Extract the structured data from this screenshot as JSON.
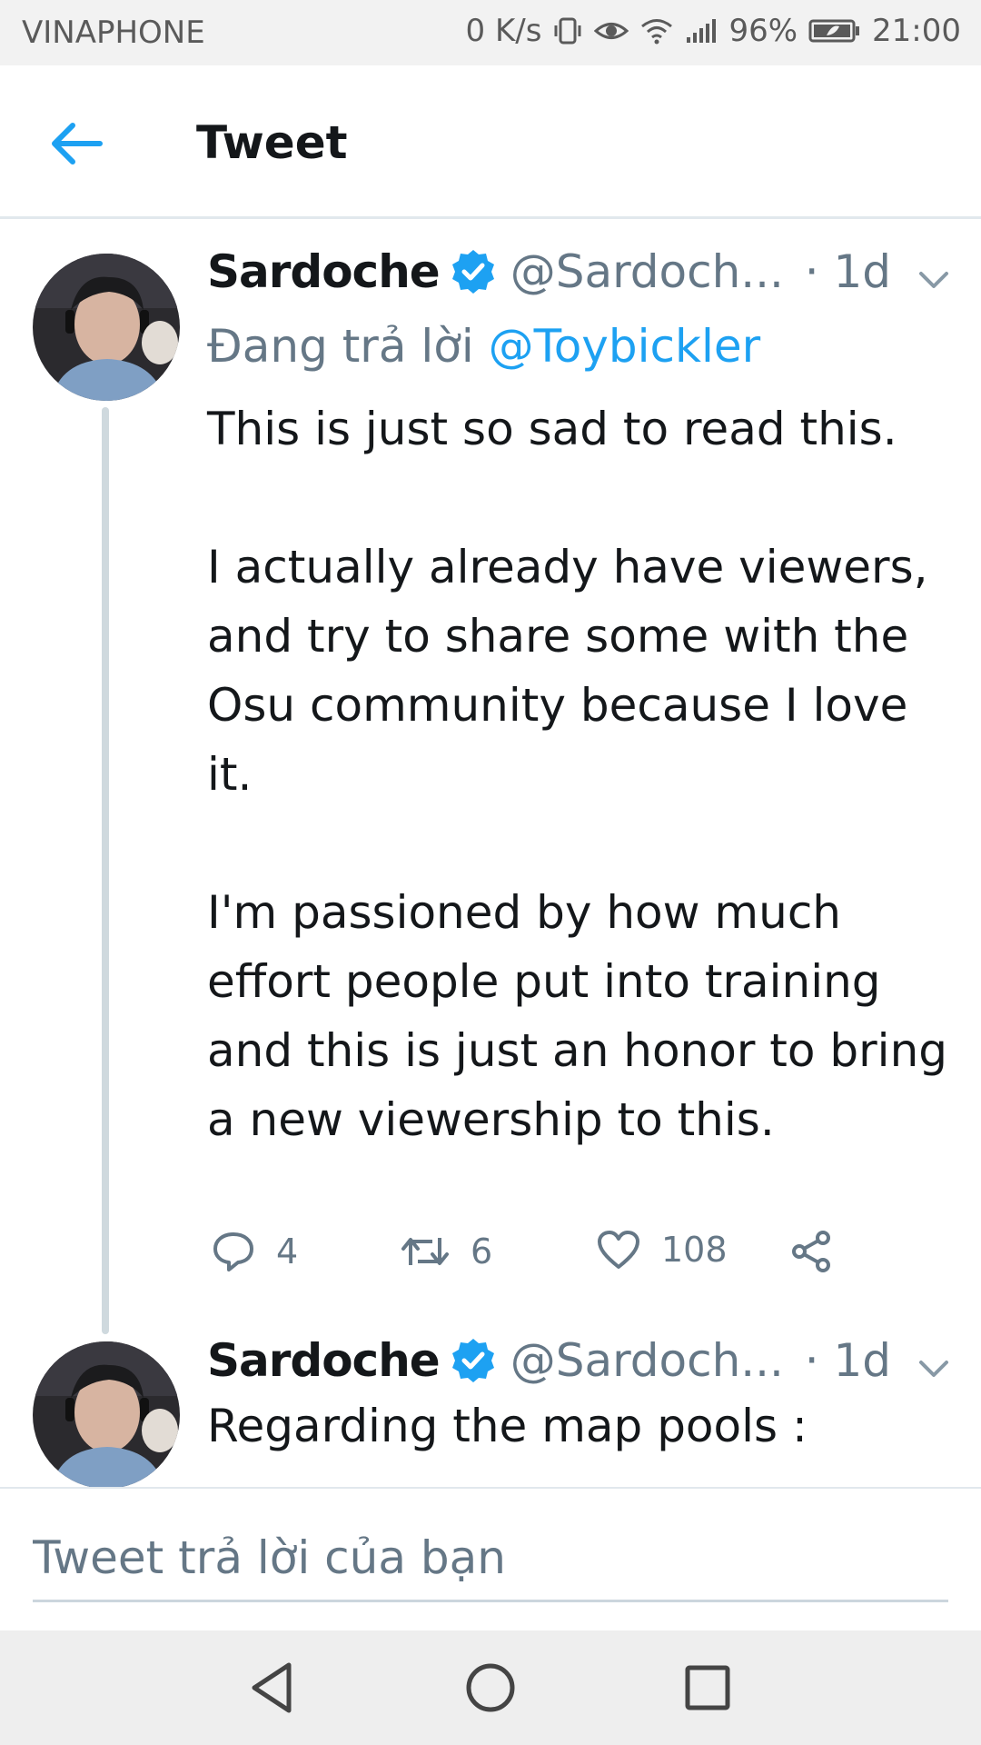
{
  "status_bar": {
    "carrier": "VINAPHONE",
    "speed": "0 K/s",
    "battery": "96%",
    "time": "21:00"
  },
  "header": {
    "title": "Tweet"
  },
  "tweets": [
    {
      "name": "Sardoche",
      "handle": "@Sardoch...",
      "time": "· 1d",
      "replying_prefix": "Đang trả lời ",
      "replying_mention": "@Toybickler",
      "paragraphs": [
        "This is just so sad to read this.",
        "I actually already have viewers, and try to share some with the Osu community because I love it.",
        "I'm passioned by how much effort people put into training and this is just an honor to bring a new viewership to this."
      ],
      "replies": "4",
      "retweets": "6",
      "likes": "108"
    },
    {
      "name": "Sardoche",
      "handle": "@Sardoch...",
      "time": "· 1d",
      "text": "Regarding the map pools :"
    }
  ],
  "composer": {
    "placeholder": "Tweet trả lời của bạn"
  },
  "colors": {
    "accent": "#1da1f2",
    "secondary_text": "#657786"
  }
}
